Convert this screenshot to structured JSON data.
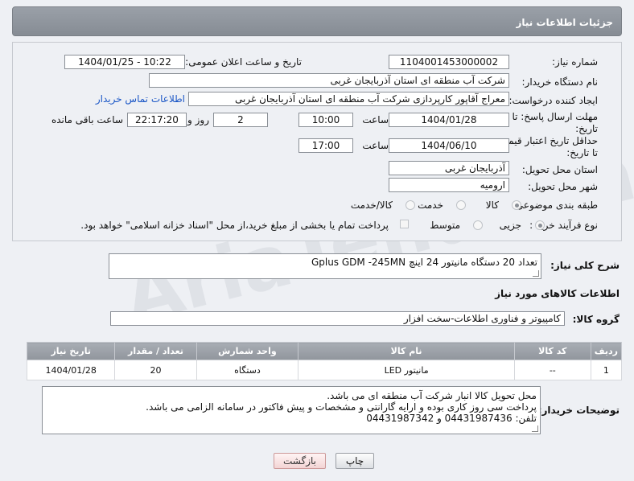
{
  "header": {
    "title": "جزئیات اطلاعات نیاز"
  },
  "fields": {
    "need_number_label": "شماره نیاز:",
    "need_number_value": "1104001453000002",
    "announce_label": "تاریخ و ساعت اعلان عمومی:",
    "announce_value": "1404/01/25 - 10:22",
    "buyer_org_label": "نام دستگاه خریدار:",
    "buyer_org_value": "شرکت آب منطقه ای استان آذربایجان غربی",
    "creator_label": "ایجاد کننده درخواست:",
    "creator_value": "معراج آقاپور کارپردازی شرکت آب منطقه ای استان آذربایجان غربی",
    "contact_link": "اطلاعات تماس خریدار",
    "deadline_label": "مهلت ارسال پاسخ: تا تاریخ:",
    "deadline_date": "1404/01/28",
    "deadline_time_label": "ساعت",
    "deadline_time": "10:00",
    "days_value": "2",
    "days_label": "روز و",
    "remaining_time": "22:17:20",
    "remaining_label": "ساعت باقی مانده",
    "price_validity_label": "حداقل تاریخ اعتبار قیمت: تا تاریخ:",
    "price_validity_date": "1404/06/10",
    "price_validity_time_label": "ساعت",
    "price_validity_time": "17:00",
    "delivery_province_label": "استان محل تحویل:",
    "delivery_province_value": "آذربایجان غربی",
    "delivery_city_label": "شهر محل تحویل:",
    "delivery_city_value": "ارومیه",
    "category_label": "طبقه بندی موضوعی:",
    "category_options": [
      "کالا",
      "خدمت",
      "کالا/خدمت"
    ],
    "category_selected": "کالا",
    "purchase_type_label": "نوع فرآیند خرید :",
    "purchase_type_options": [
      "جزیی",
      "متوسط"
    ],
    "purchase_type_selected": "جزیی",
    "payment_note": "پرداخت تمام یا بخشی از مبلغ خرید،از محل \"اسناد خزانه اسلامی\" خواهد بود."
  },
  "description": {
    "label": "شرح کلی نیاز:",
    "value": "تعداد 20 دستگاه مانیتور 24 اینچ Gplus  GDM -245MN"
  },
  "goods_section": {
    "title": "اطلاعات کالاهای مورد نیاز",
    "group_label": "گروه کالا:",
    "group_value": "کامپیوتر و فناوری اطلاعات-سخت افزار"
  },
  "table": {
    "headers": [
      "ردیف",
      "کد کالا",
      "نام کالا",
      "واحد شمارش",
      "تعداد / مقدار",
      "تاریخ نیاز"
    ],
    "rows": [
      [
        "1",
        "--",
        "مانیتور LED",
        "دستگاه",
        "20",
        "1404/01/28"
      ]
    ]
  },
  "buyer_notes": {
    "label": "توضیحات خریدار:",
    "lines": [
      "محل تحویل کالا انبار شرکت آب منطقه ای می باشد.",
      "پرداخت سی روز کاری بوده و ارایه گارانتی و مشخصات و پیش فاکتور در سامانه الزامی می باشد.",
      "تلفن: 04431987436 و 04431987342"
    ]
  },
  "buttons": {
    "print": "چاپ",
    "back": "بازگشت"
  },
  "watermark": "AriaTender.net"
}
